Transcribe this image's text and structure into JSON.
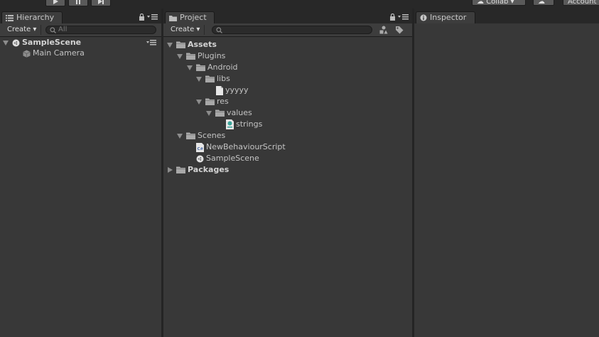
{
  "toolbar": {
    "collab_label": "Collab ▾",
    "account_label": "Account"
  },
  "hierarchy": {
    "tab_label": "Hierarchy",
    "create_label": "Create ▾",
    "search_placeholder": "All",
    "scene_name": "SampleScene",
    "items": [
      {
        "label": "Main Camera",
        "icon": "gameobject-cube-icon"
      }
    ]
  },
  "project": {
    "tab_label": "Project",
    "create_label": "Create ▾",
    "search_placeholder": "",
    "tree": [
      {
        "label": "Assets",
        "icon": "folder-icon",
        "bold": true,
        "expanded": true
      },
      {
        "label": "Plugins",
        "icon": "folder-icon",
        "expanded": true
      },
      {
        "label": "Android",
        "icon": "folder-icon",
        "expanded": true
      },
      {
        "label": "libs",
        "icon": "folder-icon",
        "expanded": true
      },
      {
        "label": "yyyyy",
        "icon": "file-icon"
      },
      {
        "label": "res",
        "icon": "folder-icon",
        "expanded": true
      },
      {
        "label": "values",
        "icon": "folder-icon",
        "expanded": true
      },
      {
        "label": "strings",
        "icon": "xml-file-icon"
      },
      {
        "label": "Scenes",
        "icon": "folder-icon",
        "expanded": true
      },
      {
        "label": "NewBehaviourScript",
        "icon": "csharp-script-icon"
      },
      {
        "label": "SampleScene",
        "icon": "unity-scene-icon"
      },
      {
        "label": "Packages",
        "icon": "folder-icon",
        "bold": true,
        "expanded": false
      }
    ]
  },
  "inspector": {
    "tab_label": "Inspector"
  },
  "colors": {
    "background": "#282828",
    "panel": "#383838",
    "tab": "#3d3d3d",
    "text": "#c4c4c4"
  }
}
